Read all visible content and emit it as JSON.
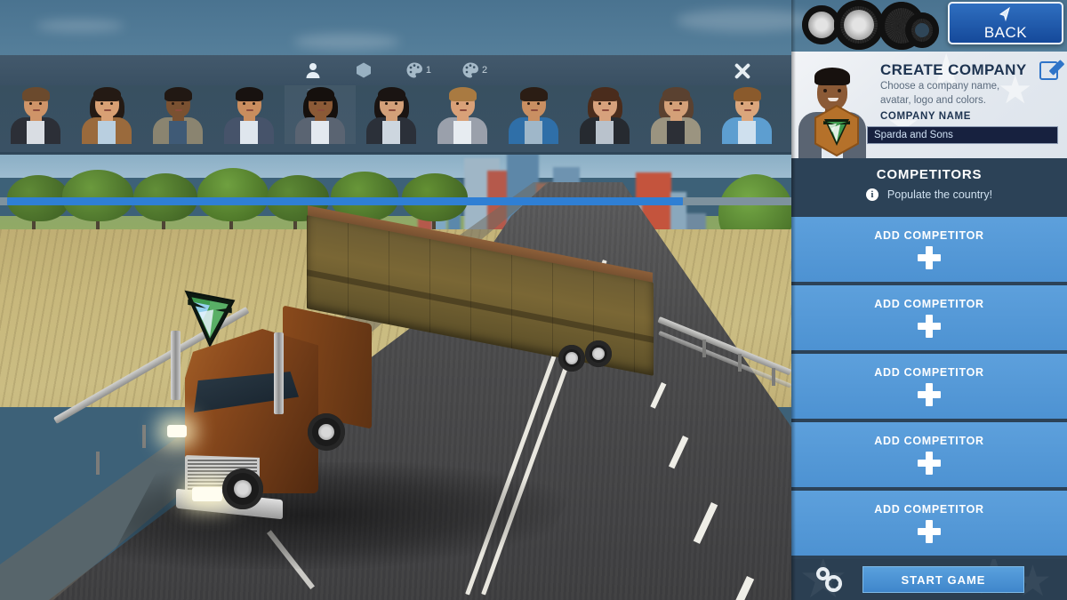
{
  "topbar": {
    "back_label": "BACK",
    "back_icon": "cursor-arrow-icon",
    "tyres_decor": "truck-tyres-image"
  },
  "avatar_panel": {
    "close_icon": "close-icon",
    "tabs": [
      {
        "id": "avatar",
        "icon": "person-icon",
        "num": "",
        "active": true
      },
      {
        "id": "logo",
        "icon": "hexagon-icon",
        "num": "",
        "active": false
      },
      {
        "id": "color1",
        "icon": "palette-icon",
        "num": "1",
        "active": false
      },
      {
        "id": "color2",
        "icon": "palette-icon",
        "num": "2",
        "active": false
      }
    ],
    "avatars": [
      {
        "id": 1,
        "skin": "#cf9468",
        "hair": "#6b4a2d",
        "hair_style": "short",
        "jacket": "#2c2f37",
        "shirt": "#d9dde3",
        "selected": false
      },
      {
        "id": 2,
        "skin": "#d8a074",
        "hair": "#241a14",
        "hair_style": "long",
        "jacket": "#9a6a3c",
        "shirt": "#b9cfe0",
        "selected": false
      },
      {
        "id": 3,
        "skin": "#7a5131",
        "hair": "#211813",
        "hair_style": "short",
        "jacket": "#8a8470",
        "shirt": "#3f5a76",
        "selected": false
      },
      {
        "id": 4,
        "skin": "#c98d5e",
        "hair": "#181210",
        "hair_style": "short",
        "jacket": "#46536a",
        "shirt": "#dfe6ed",
        "selected": false
      },
      {
        "id": 5,
        "skin": "#8b5a36",
        "hair": "#15100d",
        "hair_style": "long",
        "jacket": "#5a6472",
        "shirt": "#e3e9ef",
        "selected": true
      },
      {
        "id": 6,
        "skin": "#d3a079",
        "hair": "#1a1412",
        "hair_style": "long",
        "jacket": "#2b3039",
        "shirt": "#cdd6df",
        "selected": false
      },
      {
        "id": 7,
        "skin": "#d9a178",
        "hair": "#a97a41",
        "hair_style": "short",
        "jacket": "#9aa0ab",
        "shirt": "#e7ecf1",
        "selected": false
      },
      {
        "id": 8,
        "skin": "#c98f62",
        "hair": "#2b1d14",
        "hair_style": "short",
        "jacket": "#2f6fa8",
        "shirt": "#9fb7c9",
        "selected": false
      },
      {
        "id": 9,
        "skin": "#d7a17c",
        "hair": "#4a2c1c",
        "hair_style": "long",
        "jacket": "#262a30",
        "shirt": "#b9c2cc",
        "selected": false
      },
      {
        "id": 10,
        "skin": "#d4a078",
        "hair": "#5a4130",
        "hair_style": "long",
        "jacket": "#9b9480",
        "shirt": "#2c2f36",
        "selected": false
      },
      {
        "id": 11,
        "skin": "#dba67c",
        "hair": "#8a5a2c",
        "hair_style": "short",
        "jacket": "#5d9ed0",
        "shirt": "#cfe0ee",
        "selected": false
      }
    ],
    "scrollbar": {
      "name": "avatar-scrollbar",
      "thumb_percent": 86
    }
  },
  "create_company": {
    "title": "CREATE COMPANY",
    "subtitle": "Choose a company name, avatar, logo and colors.",
    "edit_icon": "edit-pencil-icon",
    "logo_icon": "hexagon-company-logo",
    "name_label": "COMPANY NAME",
    "name_value": "Sparda and Sons",
    "name_placeholder": "Company name"
  },
  "competitors": {
    "title": "COMPETITORS",
    "info_icon": "info-icon",
    "subtitle": "Populate the country!",
    "rows": [
      {
        "label": "ADD COMPETITOR",
        "icon": "plus-icon"
      },
      {
        "label": "ADD COMPETITOR",
        "icon": "plus-icon"
      },
      {
        "label": "ADD COMPETITOR",
        "icon": "plus-icon"
      },
      {
        "label": "ADD COMPETITOR",
        "icon": "plus-icon"
      },
      {
        "label": "ADD COMPETITOR",
        "icon": "plus-icon"
      }
    ]
  },
  "bottom_bar": {
    "settings_icon": "gears-icon",
    "start_label": "START GAME"
  },
  "colors": {
    "accent_blue": "#4d92d2",
    "panel_dark": "#2c4257",
    "back_blue": "#15499a",
    "input_navy": "#17213f",
    "logo_orange": "#b5712a",
    "logo_green": "#3f9b4f"
  },
  "scene": {
    "name": "truck-on-highway-3d-scene",
    "elements": [
      "sky",
      "city-skyline",
      "tree-line",
      "wheat-field",
      "tractor",
      "highway",
      "semi-truck",
      "guard-rail"
    ]
  }
}
